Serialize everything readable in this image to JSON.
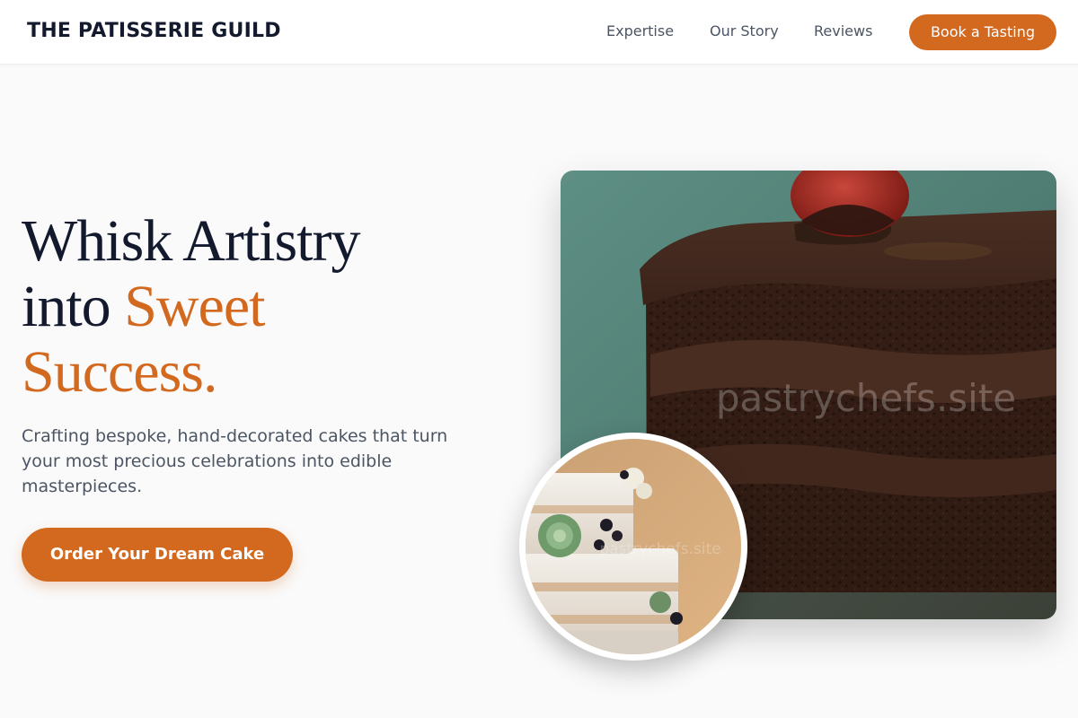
{
  "brand": {
    "name": "THE PATISSERIE GUILD"
  },
  "nav": {
    "links": [
      "Expertise",
      "Our Story",
      "Reviews"
    ],
    "cta_label": "Book a Tasting"
  },
  "hero": {
    "title_line1": "Whisk Artistry",
    "title_line2_prefix": "into ",
    "title_line2_accent": "Sweet",
    "title_line3_accent": "Success.",
    "subtitle": "Crafting bespoke, hand-decorated cakes that turn your most precious celebrations into edible masterpieces.",
    "cta_label": "Order Your Dream Cake"
  },
  "images": {
    "main_watermark": "pastrychefs.site",
    "round_watermark": "pastrychefs.site",
    "main_subject": "chocolate layer cake slice with cherry",
    "round_subject": "semi-naked tiered wedding cake with succulents and blackberries"
  },
  "colors": {
    "accent": "#d2691e",
    "heading": "#141a2e",
    "body_text": "#4b5563",
    "background": "#fafafa"
  }
}
